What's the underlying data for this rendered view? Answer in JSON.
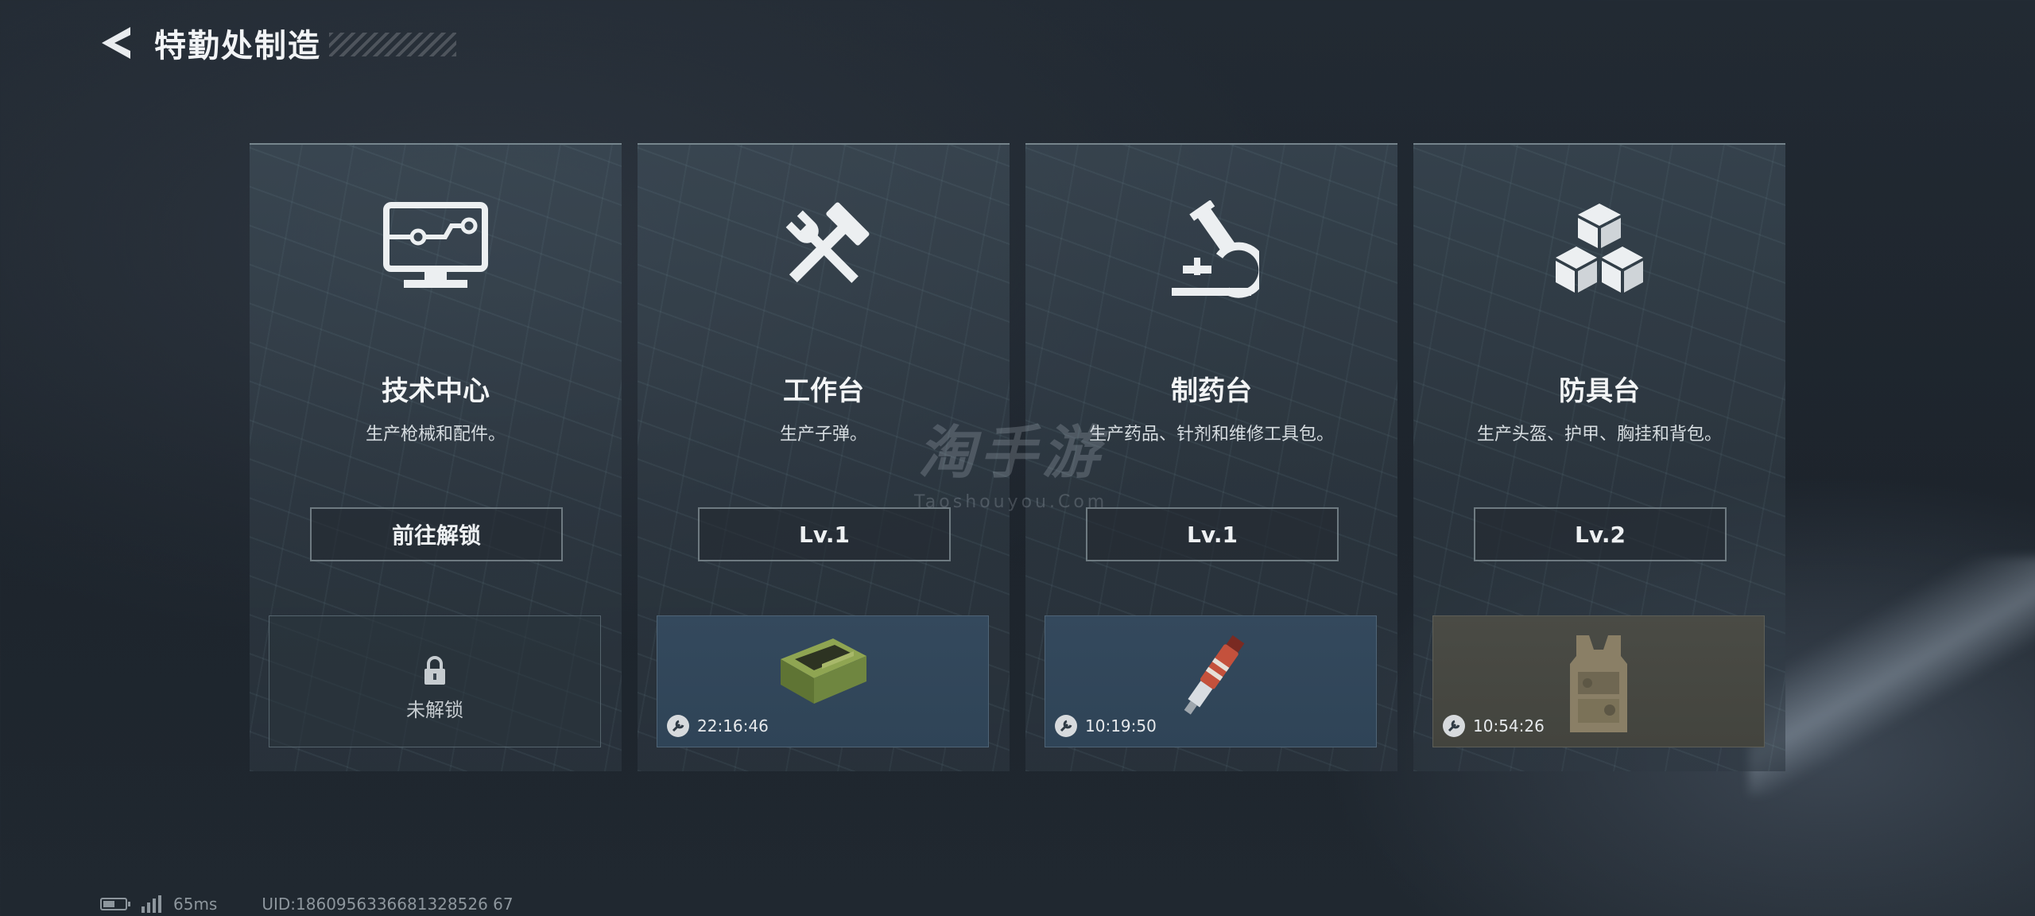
{
  "header": {
    "title": "特勤处制造",
    "back_icon": "back-arrow-icon"
  },
  "cards": [
    {
      "title": "技术中心",
      "desc": "生产枪械和配件。",
      "button": "前往解锁",
      "icon": "monitor-icon",
      "slot": {
        "state": "locked",
        "label": "未解锁",
        "icon": "lock-icon"
      }
    },
    {
      "title": "工作台",
      "desc": "生产子弹。",
      "button": "Lv.1",
      "icon": "hammer-wrench-icon",
      "slot": {
        "state": "producing",
        "timer": "22:16:46",
        "item_icon": "ammo-box-icon"
      }
    },
    {
      "title": "制药台",
      "desc": "生产药品、针剂和维修工具包。",
      "button": "Lv.1",
      "icon": "microscope-icon",
      "slot": {
        "state": "producing",
        "timer": "10:19:50",
        "item_icon": "injector-icon"
      }
    },
    {
      "title": "防具台",
      "desc": "生产头盔、护甲、胸挂和背包。",
      "button": "Lv.2",
      "icon": "cubes-icon",
      "slot": {
        "state": "producing",
        "timer": "10:54:26",
        "item_icon": "vest-icon"
      }
    }
  ],
  "watermark": {
    "cn": "淘手游",
    "en": "Taoshouyou.Com"
  },
  "status": {
    "ping": "65ms",
    "uid": "UID:1860956336681328526 67"
  },
  "colors": {
    "slot_blue": "#34495d",
    "slot_brown": "#4a4b45",
    "text_primary": "#f3f5f6"
  }
}
